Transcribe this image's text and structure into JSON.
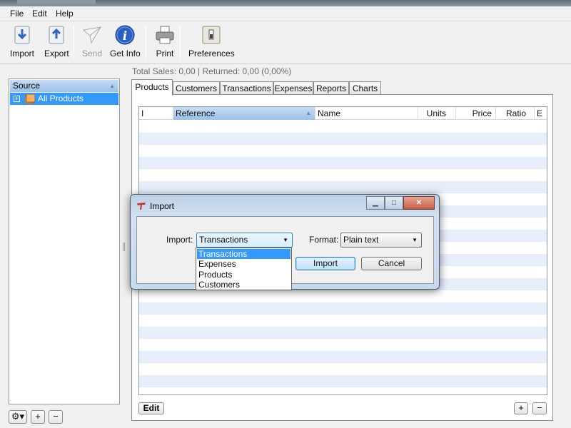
{
  "menubar": {
    "items": [
      "File",
      "Edit",
      "Help"
    ]
  },
  "toolbar": {
    "buttons": [
      {
        "label": "Import",
        "icon": "import-icon",
        "enabled": true
      },
      {
        "label": "Export",
        "icon": "export-icon",
        "enabled": true
      },
      {
        "label": "Send",
        "icon": "paper-plane-icon",
        "enabled": false
      },
      {
        "label": "Get Info",
        "icon": "info-icon",
        "enabled": true
      },
      {
        "label": "Print",
        "icon": "printer-icon",
        "enabled": true
      },
      {
        "label": "Preferences",
        "icon": "switch-icon",
        "enabled": true
      }
    ]
  },
  "sidebar": {
    "header": "Source",
    "items": [
      {
        "label": "All Products",
        "selected": true,
        "expandable": true
      }
    ],
    "tool_buttons": [
      "gear-icon",
      "+",
      "−"
    ]
  },
  "status": "Total Sales: 0,00 | Returned: 0,00 (0,00%)",
  "tabs": [
    {
      "label": "Products",
      "active": true
    },
    {
      "label": "Customers",
      "active": false
    },
    {
      "label": "Transactions",
      "active": false
    },
    {
      "label": "Expenses",
      "active": false
    },
    {
      "label": "Reports",
      "active": false
    },
    {
      "label": "Charts",
      "active": false
    }
  ],
  "table": {
    "columns": [
      "I",
      "Reference",
      "Name",
      "Units",
      "Price",
      "Ratio",
      "E"
    ],
    "sorted_column": "Reference",
    "rows": []
  },
  "footer": {
    "edit_label": "Edit",
    "add_label": "+",
    "remove_label": "−"
  },
  "dialog": {
    "title": "Import",
    "import_label": "Import:",
    "import_value": "Transactions",
    "format_label": "Format:",
    "format_value": "Plain text",
    "import_button": "Import",
    "cancel_button": "Cancel",
    "dropdown_options": [
      "Transactions",
      "Expenses",
      "Products",
      "Customers"
    ],
    "dropdown_selected": "Transactions"
  },
  "colors": {
    "selection": "#3399ff",
    "header_blue": "#9bc1ea",
    "row_stripe": "#e7eefb",
    "dialog_frame": "#c7d9ec"
  }
}
